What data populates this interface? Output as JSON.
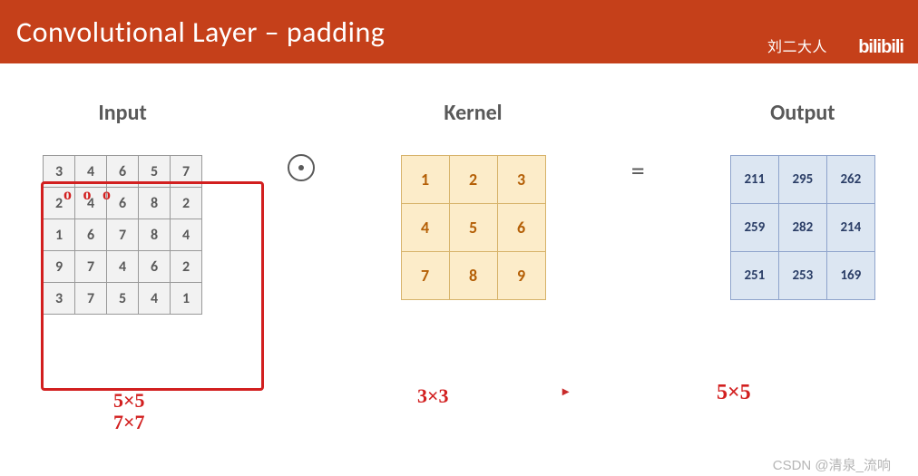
{
  "header": {
    "title": "Convolutional Layer – padding",
    "author": "刘二大人",
    "logo": "bilibili"
  },
  "headings": {
    "input": "Input",
    "kernel": "Kernel",
    "output": "Output"
  },
  "operators": {
    "conv": "⊙",
    "eq": "="
  },
  "input_grid": [
    [
      "3",
      "4",
      "6",
      "5",
      "7"
    ],
    [
      "2",
      "4",
      "6",
      "8",
      "2"
    ],
    [
      "1",
      "6",
      "7",
      "8",
      "4"
    ],
    [
      "9",
      "7",
      "4",
      "6",
      "2"
    ],
    [
      "3",
      "7",
      "5",
      "4",
      "1"
    ]
  ],
  "kernel_grid": [
    [
      "1",
      "2",
      "3"
    ],
    [
      "4",
      "5",
      "6"
    ],
    [
      "7",
      "8",
      "9"
    ]
  ],
  "output_grid": [
    [
      "211",
      "295",
      "262"
    ],
    [
      "259",
      "282",
      "214"
    ],
    [
      "251",
      "253",
      "169"
    ]
  ],
  "annotations": {
    "input_dots": "o o  o",
    "input_sizes_line1": "5×5",
    "input_sizes_line2": "7×7",
    "kernel_size": "3×3",
    "output_size": "5×5",
    "cursor": "▸"
  },
  "watermark": "CSDN @清泉_流响"
}
